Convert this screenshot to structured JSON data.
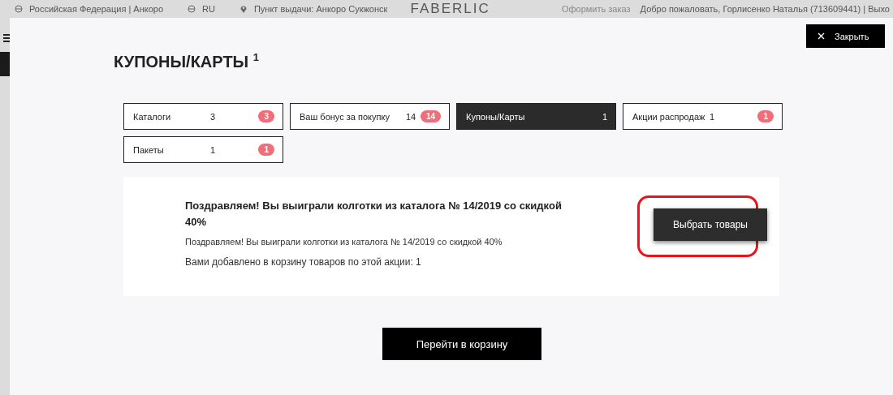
{
  "background_header": {
    "items": [
      {
        "kind": "globe",
        "text": "Российская Федерация | Анкоро"
      },
      {
        "kind": "globe",
        "text": "RU"
      },
      {
        "kind": "pin",
        "text": "Пункт выдачи: Анкоро Сукжонск"
      }
    ],
    "logo": "FABERLIC",
    "links": [
      "Оформить заказ",
      "Добро пожаловать, Горлисенко Наталья (713609441) | Выхо"
    ]
  },
  "modal": {
    "close_button": "Закрыть",
    "title": "КУПОНЫ/КАРТЫ $^{1}$",
    "tabs": [
      {
        "label": "Каталоги",
        "count": "3",
        "badge": "3",
        "selected": false
      },
      {
        "label": "Ваш бонус за покупку",
        "count": "14",
        "badge": "14",
        "selected": false
      },
      {
        "label": "Купоны/Карты",
        "count": "1",
        "selected": true
      },
      {
        "label": "Акции распродаж",
        "count": "1",
        "badge": "1",
        "selected": false
      },
      {
        "label": "Пакеты",
        "count": "1",
        "badge": "1",
        "selected": false
      }
    ],
    "coupon": {
      "heading": "Поздравляем! Вы выиграли колготки из каталога № 14/2019 со скидкой 40%",
      "description": "Поздравляем! Вы выиграли колготки из каталога № 14/2019 со скидкой 40%",
      "added_note": "Вами добавлено в корзину товаров по этой акции: 1",
      "button": {
        "label": "Выбрать товары",
        "highlighted": true
      }
    },
    "cart_button": "Перейти в корзину"
  }
}
